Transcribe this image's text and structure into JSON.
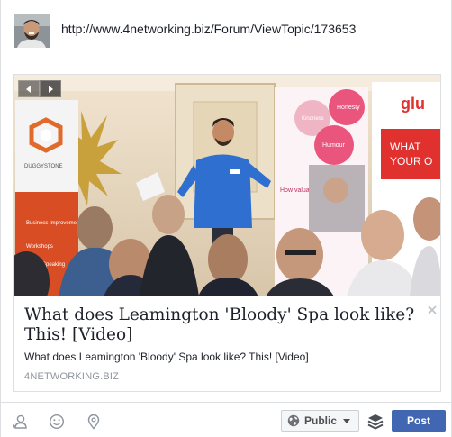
{
  "composer": {
    "url": "http://www.4networking.biz/Forum/ViewTopic/173653"
  },
  "preview": {
    "title": "What does Leamington 'Bloody' Spa look like? This! [Video]",
    "description": "What does Leamington 'Bloody' Spa look like? This! [Video]",
    "domain": "4NETWORKING.BIZ",
    "banner_left": {
      "brand": "DUGGYSTONE",
      "items": [
        "Business Improvement",
        "Workshops",
        "Public Speaking"
      ]
    },
    "banner_right": {
      "bubbles": [
        "Kindness",
        "Honesty",
        "Humour"
      ],
      "question": "How valuable is your time?",
      "logo": "glu",
      "tag_top": "WHAT",
      "tag_bottom": "YOUR O"
    }
  },
  "footer": {
    "audience_label": "Public",
    "post_label": "Post"
  },
  "colors": {
    "accent": "#4267b2",
    "border": "#dddfe2",
    "text": "#1d2129",
    "muted": "#90949c"
  }
}
